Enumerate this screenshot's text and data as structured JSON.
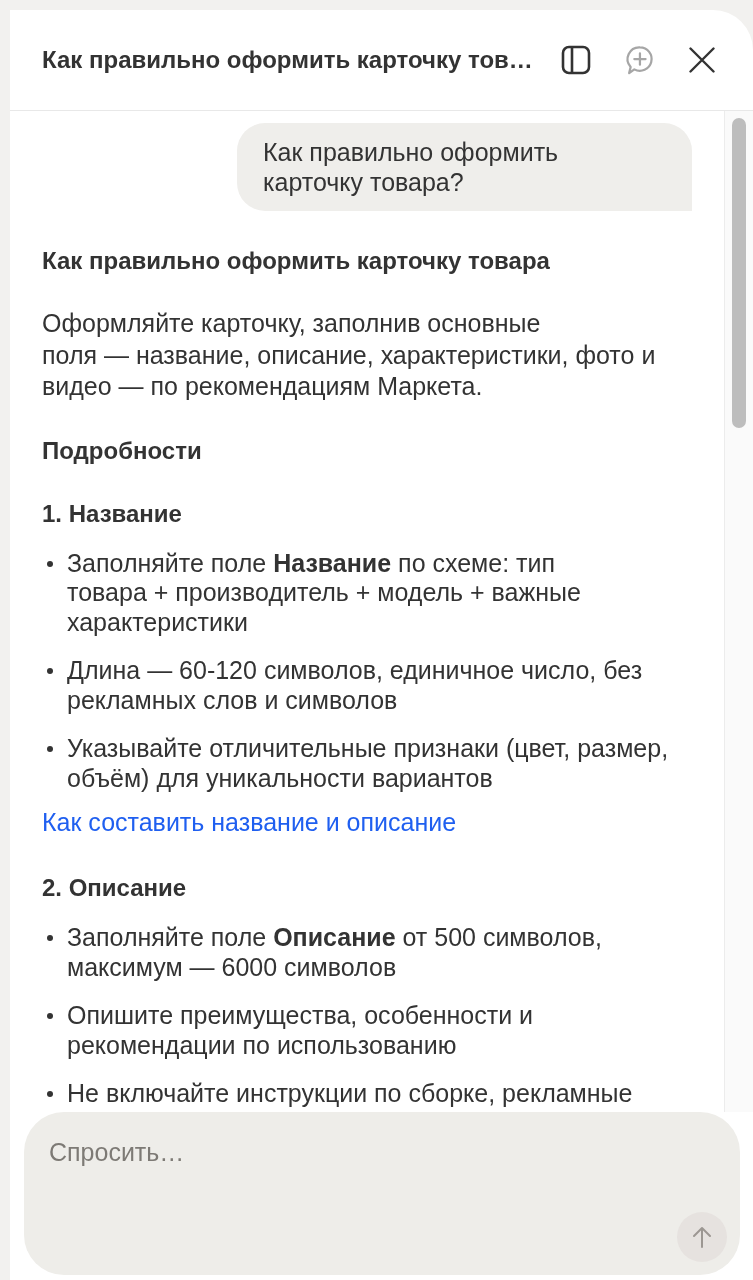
{
  "header": {
    "title": "Как правильно оформить карточку тов…",
    "actions": [
      {
        "kind": "sidebar",
        "disabled": false
      },
      {
        "kind": "new_chat",
        "disabled": true
      },
      {
        "kind": "close",
        "disabled": false
      }
    ]
  },
  "chat": {
    "user_message": "Как правильно оформить карточку товара?",
    "answer": [
      {
        "kind": "heading",
        "text": "Как правильно оформить карточку товара"
      },
      {
        "kind": "paragraph",
        "text": "Оформляйте карточку, заполнив основные поля — название, описание, характеристики, фото и видео — по рекомендациям Маркета."
      },
      {
        "kind": "heading",
        "text": "Подробности"
      },
      {
        "kind": "heading",
        "text": "1. Название"
      },
      {
        "kind": "list",
        "items": [
          "Заполняйте поле **Название** по схеме: тип товара + производитель + модель + важные характеристики",
          "Длина — 60-120 символов, единичное число, без рекламных слов и символов",
          "Указывайте отличительные признаки (цвет, размер, объём) для уникальности вариантов"
        ]
      },
      {
        "kind": "link",
        "text": "Как составить название и описание"
      },
      {
        "kind": "heading",
        "text": "2. Описание"
      },
      {
        "kind": "list",
        "items": [
          "Заполняйте поле **Описание** от 500 символов, максимум — 6000 символов",
          "Опишите преимущества, особенности и рекомендации по использованию",
          "Не включайте инструкции по сборке, рекламные"
        ]
      }
    ]
  },
  "composer": {
    "placeholder": "Спросить…",
    "send_button": {
      "disabled": true
    }
  }
}
